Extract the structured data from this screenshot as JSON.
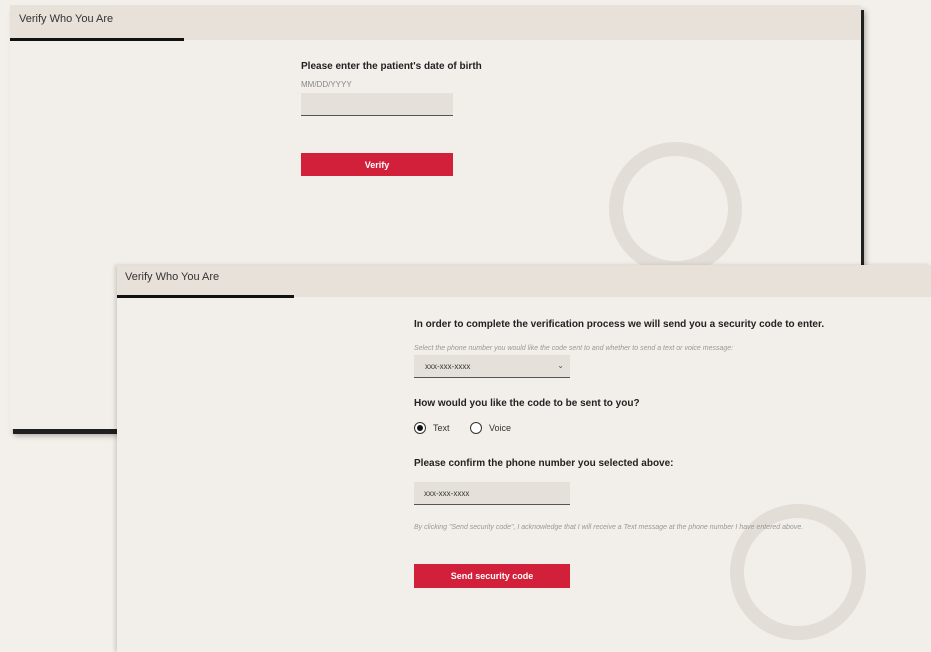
{
  "window1": {
    "title": "Verify Who You Are",
    "dob_label": "Please enter the patient's date of birth",
    "dob_hint": "MM/DD/YYYY",
    "dob_value": "",
    "verify_button": "Verify"
  },
  "window2": {
    "title": "Verify Who You Are",
    "intro": "In order to complete the verification process we will send you a security code to enter.",
    "select_hint": "Select the phone number you would like the code sent to and whether to send a text or voice message:",
    "phone_select_value": "xxx-xxx-xxxx",
    "method_question": "How would you like the code to be sent to you?",
    "method_options": {
      "text": "Text",
      "voice": "Voice",
      "selected": "Text"
    },
    "confirm_label": "Please confirm the phone number you selected above:",
    "confirm_value": "xxx-xxx-xxxx",
    "disclaimer": "By clicking \"Send security code\", I acknowledge that I will receive a Text message at the phone number I have entered above.",
    "send_button": "Send security code"
  },
  "icons": [
    "chevron-down-icon"
  ],
  "colors": {
    "accent": "#d3203a",
    "background": "#f2eee9",
    "titlebar": "#e8e1d9",
    "input": "#e5e0da"
  }
}
